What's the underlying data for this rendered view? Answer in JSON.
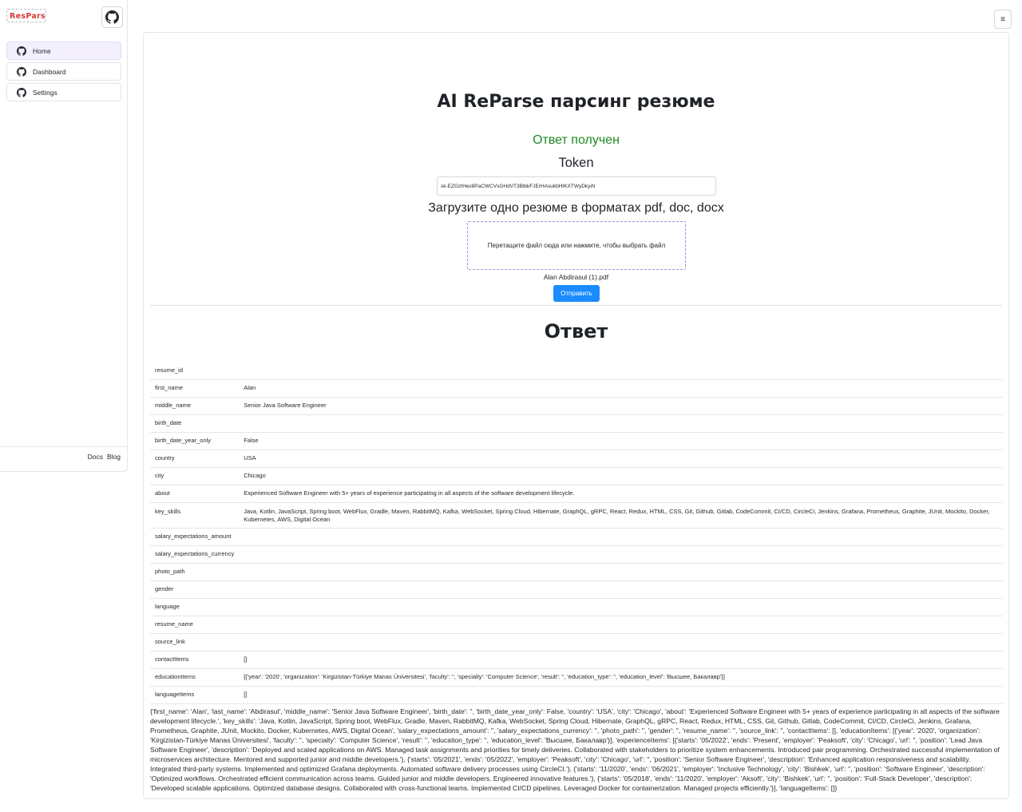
{
  "sidebar": {
    "logo_text": "ResParse",
    "items": [
      {
        "label": "Home",
        "active": true
      },
      {
        "label": "Dashboard",
        "active": false
      },
      {
        "label": "Settings",
        "active": false
      }
    ],
    "footer_links": [
      "Docs",
      "Blog"
    ]
  },
  "header": {
    "menu_icon": "≡"
  },
  "main": {
    "title": "AI ReParse парсинг резюме",
    "status": "Ответ получен",
    "token_label": "Token",
    "token_value": "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",
    "upload_label": "Загрузите одно резюме в форматах pdf, doc, docx",
    "dropzone_text": "Перетащите файл сюда или нажмите, чтобы выбрать файл",
    "filename": "Alan Abdirasul (1).pdf",
    "submit_label": "Отправить",
    "answer_title": "Ответ"
  },
  "result_rows": [
    {
      "key": "resume_id",
      "value": ""
    },
    {
      "key": "first_name",
      "value": "Alan"
    },
    {
      "key": "middle_name",
      "value": "Senior Java Software Engineer"
    },
    {
      "key": "birth_date",
      "value": ""
    },
    {
      "key": "birth_date_year_only",
      "value": "False"
    },
    {
      "key": "country",
      "value": "USA"
    },
    {
      "key": "city",
      "value": "Chicago"
    },
    {
      "key": "about",
      "value": "Experienced Software Engineer with 5+ years of experience participating in all aspects of the software development lifecycle."
    },
    {
      "key": "key_skills",
      "value": "Java, Kotlin, JavaScript, Spring boot, WebFlux, Gradle, Maven, RabbitMQ, Kafka, WebSocket, Spring Cloud, Hibernate, GraphQL, gRPC, React, Redux, HTML, CSS, Git, Github, Gitlab, CodeCommit, CI/CD, CircleCi, Jenkins, Grafana, Prometheus, Graphite, JUnit, Mockito, Docker, Kubernetes, AWS, Digital Ocean"
    },
    {
      "key": "salary_expectations_amount",
      "value": ""
    },
    {
      "key": "salary_expectations_currency",
      "value": ""
    },
    {
      "key": "photo_path",
      "value": ""
    },
    {
      "key": "gender",
      "value": ""
    },
    {
      "key": "language",
      "value": ""
    },
    {
      "key": "resume_name",
      "value": ""
    },
    {
      "key": "source_link",
      "value": ""
    },
    {
      "key": "contactItems",
      "value": "[]"
    },
    {
      "key": "educationItems",
      "value": "[{'year': '2020', 'organization': 'Kirgizistan-Türkiye Manas Üniversitesi', 'faculty': '', 'specialty': 'Computer Science', 'result': '', 'education_type': '', 'education_level': 'Высшее, Бакалавр'}]"
    },
    {
      "key": "languageItems",
      "value": "[]"
    }
  ],
  "raw_response": "{'first_name': 'Alan', 'last_name': 'Abdirasul', 'middle_name': 'Senior Java Software Engineer', 'birth_date': '', 'birth_date_year_only': False, 'country': 'USA', 'city': 'Chicago', 'about': 'Experienced Software Engineer with 5+ years of experience participating in all aspects of the software development lifecycle.', 'key_skills': 'Java, Kotlin, JavaScript, Spring boot, WebFlux, Gradle, Maven, RabbitMQ, Kafka, WebSocket, Spring Cloud, Hibernate, GraphQL, gRPC, React, Redux, HTML, CSS, Git, Github, Gitlab, CodeCommit, CI/CD, CircleCi, Jenkins, Grafana, Prometheus, Graphite, JUnit, Mockito, Docker, Kubernetes, AWS, Digital Ocean', 'salary_expectations_amount': '', 'salary_expectations_currency': '', 'photo_path': '', 'gender': '', 'resume_name': '', 'source_link': '', 'contactItems': [], 'educationItems': [{'year': '2020', 'organization': 'Kirgizistan-Türkiye Manas Üniversitesi', 'faculty': '', 'specialty': 'Computer Science', 'result': '', 'education_type': '', 'education_level': 'Высшее, Бакалавр'}], 'experienceItems': [{'starts': '05/2022', 'ends': 'Present', 'employer': 'Peaksoft', 'city': 'Chicago', 'url': '', 'position': 'Lead Java Software Engineer', 'description': 'Deployed and scaled applications on AWS. Managed task assignments and priorities for timely deliveries. Collaborated with stakeholders to prioritize system enhancements. Introduced pair programming. Orchestrated successful implementation of microservices architecture. Mentored and supported junior and middle developers.'}, {'starts': '05/2021', 'ends': '05/2022', 'employer': 'Peaksoft', 'city': 'Chicago', 'url': '', 'position': 'Senior Software Engineer', 'description': 'Enhanced application responsiveness and scalability. Integrated third-party systems. Implemented and optimized Grafana deployments. Automated software delivery processes using CircleCI.'}, {'starts': '11/2020', 'ends': '06/2021', 'employer': 'Inclusive Technology', 'city': 'Bishkek', 'url': '', 'position': 'Software Engineer', 'description': 'Optimized workflows. Orchestrated efficient communication across teams. Guided junior and middle developers. Engineered innovative features.'}, {'starts': '05/2018', 'ends': '11/2020', 'employer': 'Aksoft', 'city': 'Bishkek', 'url': '', 'position': 'Full-Stack Developer', 'description': 'Developed scalable applications. Optimized database designs. Collaborated with cross-functional teams. Implemented CI/CD pipelines. Leveraged Docker for containerization. Managed projects efficiently.'}], 'languageItems': []}"
}
